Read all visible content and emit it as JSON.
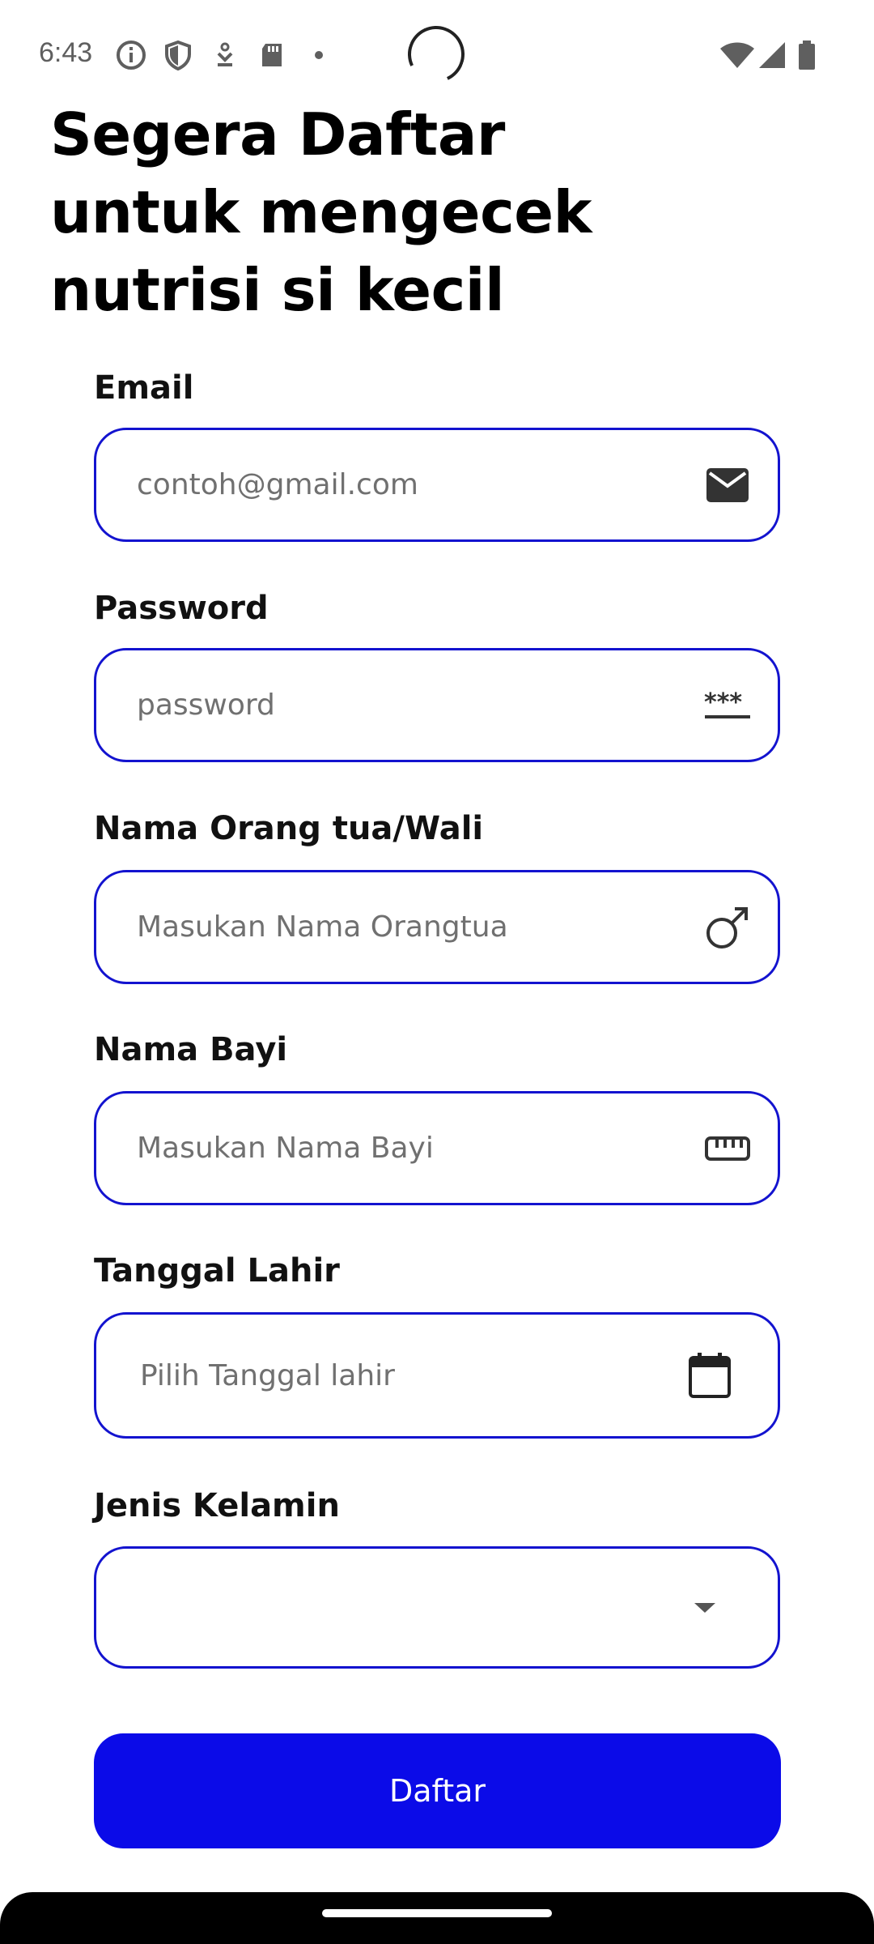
{
  "status_bar": {
    "time": "6:43",
    "left_icons": [
      "info-icon",
      "shield-icon",
      "download-icon",
      "sd-card-icon",
      "dot-icon"
    ],
    "right_icons": [
      "wifi-icon",
      "signal-icon",
      "battery-icon"
    ]
  },
  "header": {
    "title": "Segera Daftar\nuntuk mengecek\nnutrisi si kecil"
  },
  "form": {
    "email": {
      "label": "Email",
      "placeholder": "contoh@gmail.com",
      "value": "",
      "icon": "mail-icon"
    },
    "password": {
      "label": "Password",
      "placeholder": "password",
      "value": "",
      "icon": "password-icon"
    },
    "parent_name": {
      "label": "Nama Orang tua/Wali",
      "placeholder": "Masukan Nama Orangtua",
      "value": "",
      "icon": "male-icon"
    },
    "baby_name": {
      "label": "Nama Bayi",
      "placeholder": "Masukan Nama Bayi",
      "value": "",
      "icon": "ruler-icon"
    },
    "birth_date": {
      "label": "Tanggal Lahir",
      "placeholder": "Pilih Tanggal lahir",
      "value": "",
      "icon": "calendar-icon"
    },
    "gender": {
      "label": "Jenis Kelamin",
      "selected": "",
      "icon": "dropdown-arrow-icon"
    },
    "submit_label": "Daftar"
  },
  "colors": {
    "accent": "#0b0be8",
    "field_border": "#1313cf",
    "placeholder": "#707070"
  }
}
